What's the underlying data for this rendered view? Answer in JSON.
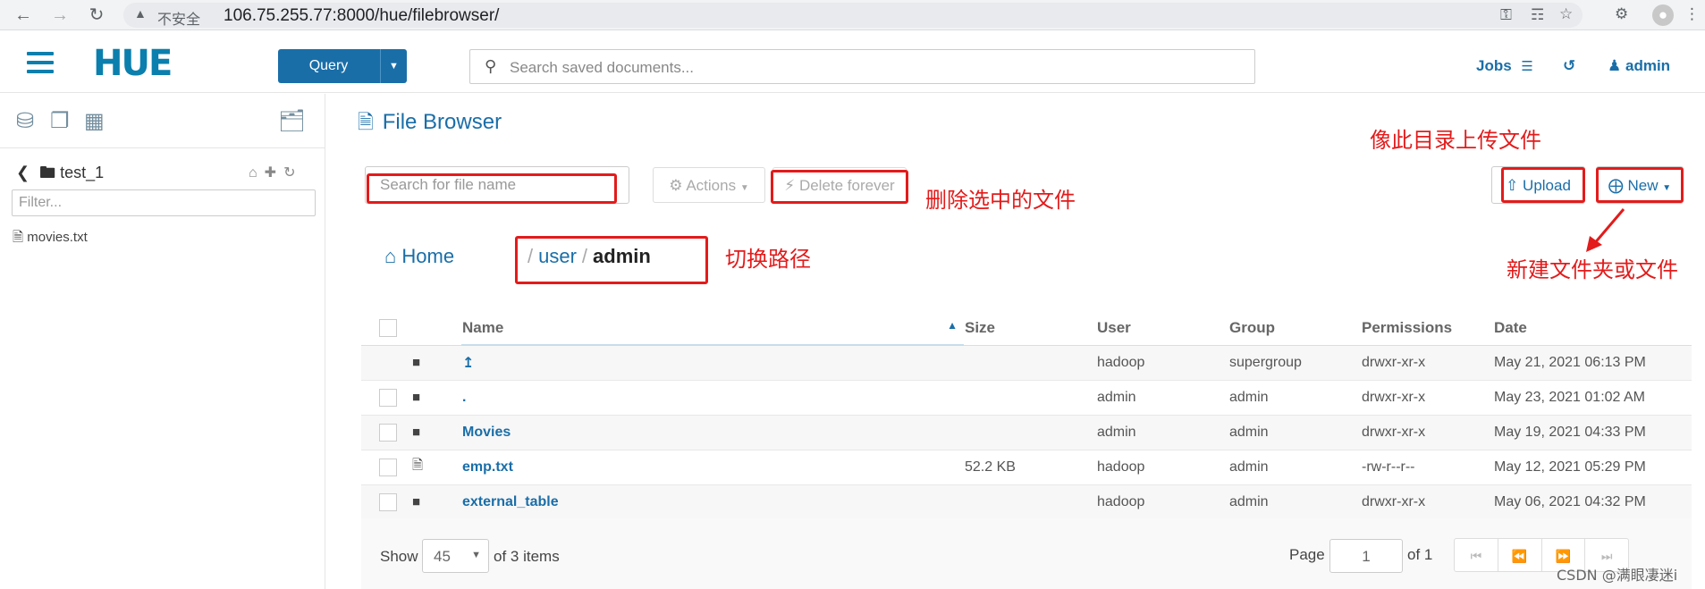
{
  "browser": {
    "insecure_label": "不安全",
    "url": "106.75.255.77:8000/hue/filebrowser/"
  },
  "header": {
    "logo": "HUE",
    "query_label": "Query",
    "search_placeholder": "Search saved documents...",
    "jobs_label": "Jobs",
    "user_label": "admin"
  },
  "sidebar": {
    "folder": "test_1",
    "filter_placeholder": "Filter...",
    "files": [
      "movies.txt"
    ]
  },
  "filebrowser": {
    "title": "File Browser",
    "search_placeholder": "Search for file name",
    "actions_label": "Actions",
    "delete_label": "Delete forever",
    "upload_label": "Upload",
    "new_label": "New",
    "home_label": "Home",
    "breadcrumb": {
      "sep1": "/",
      "part1": "user",
      "sep2": "/",
      "part2": "admin"
    },
    "columns": {
      "name": "Name",
      "size": "Size",
      "user": "User",
      "group": "Group",
      "permissions": "Permissions",
      "date": "Date"
    },
    "rows": [
      {
        "name": "↥",
        "size": "",
        "user": "hadoop",
        "group": "supergroup",
        "permissions": "drwxr-xr-x",
        "date": "May 21, 2021 06:13 PM",
        "icon": "folder-icon"
      },
      {
        "name": ".",
        "size": "",
        "user": "admin",
        "group": "admin",
        "permissions": "drwxr-xr-x",
        "date": "May 23, 2021 01:02 AM",
        "icon": "folder-icon"
      },
      {
        "name": "Movies",
        "size": "",
        "user": "admin",
        "group": "admin",
        "permissions": "drwxr-xr-x",
        "date": "May 19, 2021 04:33 PM",
        "icon": "folder-icon"
      },
      {
        "name": "emp.txt",
        "size": "52.2 KB",
        "user": "hadoop",
        "group": "admin",
        "permissions": "-rw-r--r--",
        "date": "May 12, 2021 05:29 PM",
        "icon": "file-icon"
      },
      {
        "name": "external_table",
        "size": "",
        "user": "hadoop",
        "group": "admin",
        "permissions": "drwxr-xr-x",
        "date": "May 06, 2021 04:32 PM",
        "icon": "folder-icon"
      }
    ],
    "footer": {
      "show": "Show",
      "page_size": "45",
      "items_text": "of 3 items",
      "page_label": "Page",
      "page_value": "1",
      "of_pages": "of 1"
    }
  },
  "annotations": {
    "upload_note": "像此目录上传文件",
    "delete_note": "删除选中的文件",
    "path_note": "切换路径",
    "new_note": "新建文件夹或文件"
  },
  "watermark": "CSDN @满眼凄迷i",
  "colors": {
    "accent": "#1a6ea8",
    "annotation": "#e31b1b"
  }
}
